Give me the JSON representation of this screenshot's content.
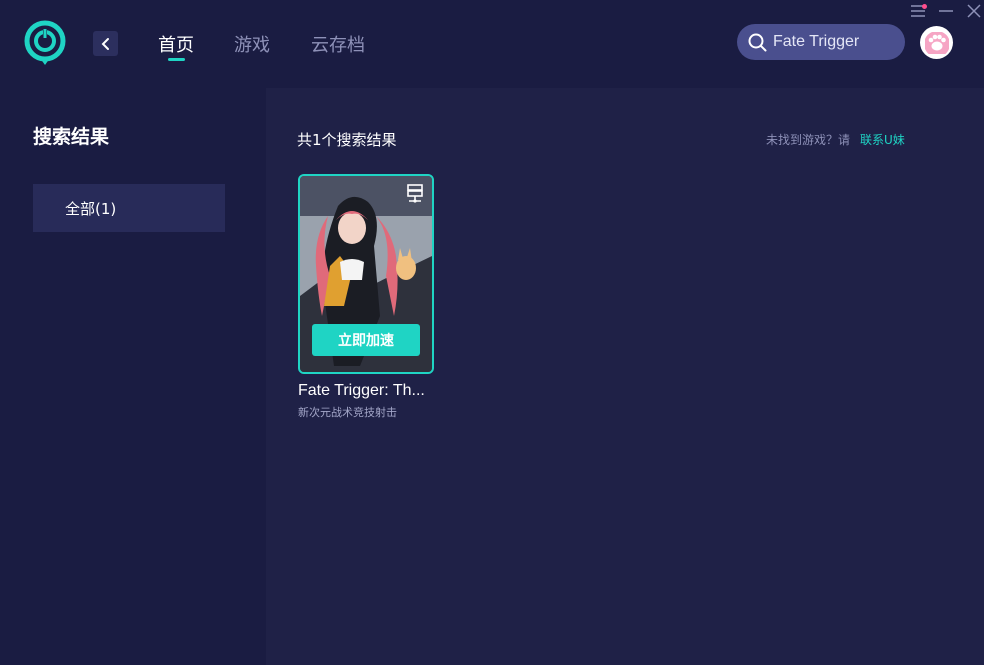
{
  "nav": {
    "tabs": [
      {
        "label": "首页",
        "active": true
      },
      {
        "label": "游戏",
        "active": false
      },
      {
        "label": "云存档",
        "active": false
      }
    ]
  },
  "search": {
    "value": "Fate Trigger",
    "icon": "search-icon"
  },
  "sidebar": {
    "title": "搜索结果",
    "filters": [
      {
        "label": "全部(1)"
      }
    ]
  },
  "main": {
    "result_count": "共1个搜索结果",
    "not_found_text": "未找到游戏？请",
    "contact_link": "联系U妹",
    "games": [
      {
        "title": "Fate Trigger: Th...",
        "subtitle": "新次元战术竞技射击",
        "accelerate_label": "立即加速"
      }
    ]
  },
  "colors": {
    "accent": "#1fd4c4",
    "background": "#1e1f45",
    "notify": "#ff4d8d"
  }
}
